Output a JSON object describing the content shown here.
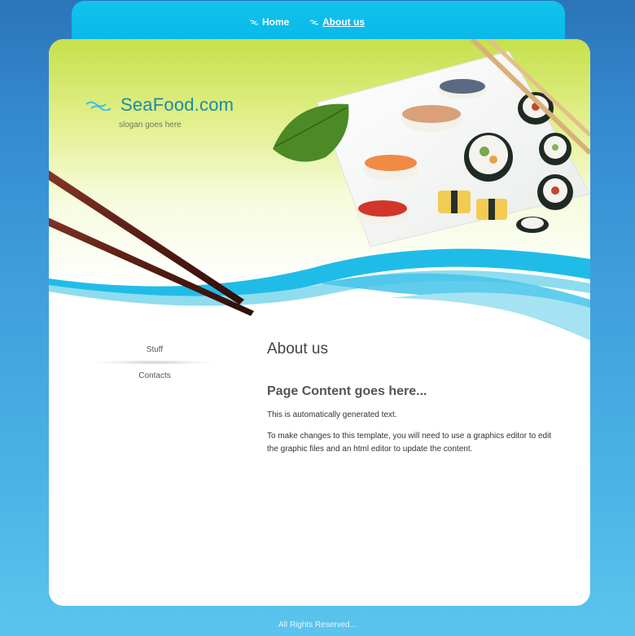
{
  "nav": {
    "items": [
      {
        "label": "Home"
      },
      {
        "label": "About us"
      }
    ]
  },
  "header": {
    "logo_text": "SeaFood.com",
    "slogan": "slogan goes here"
  },
  "sidebar": {
    "items": [
      {
        "label": "Stuff"
      },
      {
        "label": "Contacts"
      }
    ]
  },
  "content": {
    "title": "About us",
    "subtitle": "Page Content goes here...",
    "paragraphs": [
      "This is automatically generated text.",
      "To make changes to this template, you will need to use a graphics editor to edit the graphic files and an html editor to update the content."
    ]
  },
  "footer": {
    "text": "All Rights Reserved..."
  },
  "colors": {
    "nav_bar": "#06b6e6",
    "background_top": "#2b74b8",
    "background_bottom": "#5bc4ee",
    "logo": "#1c8aa6",
    "header_green": "#c6e04a",
    "wave_blue": "#1fb9e6"
  }
}
